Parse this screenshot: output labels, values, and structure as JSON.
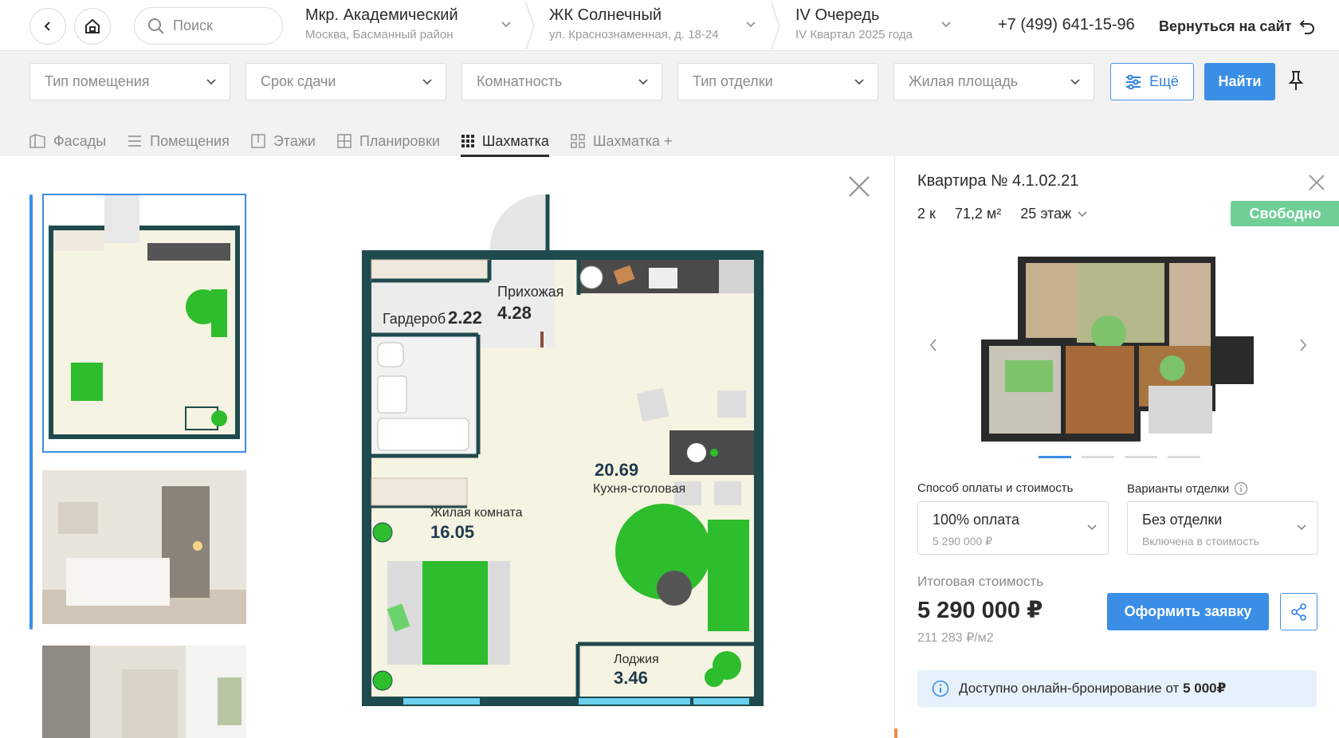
{
  "header": {
    "search_placeholder": "Поиск",
    "district": {
      "title": "Мкр. Академический",
      "subtitle": "Москва, Басманный район"
    },
    "complex": {
      "title": "ЖК Солнечный",
      "subtitle": "ул. Краснознаменная, д. 18-24"
    },
    "stage": {
      "title": "IV Очередь",
      "subtitle": "IV Квартал 2025 года"
    },
    "phone": "+7 (499) 641-15-96",
    "back_to_site": "Вернуться на сайт"
  },
  "filters": {
    "items": [
      "Тип помещения",
      "Срок сдачи",
      "Комнатность",
      "Тип отделки",
      "Жилая площадь"
    ],
    "more_label": "Ещё",
    "find_label": "Найти"
  },
  "tabs": [
    {
      "label": "Фасады",
      "icon": "facade-icon"
    },
    {
      "label": "Помещения",
      "icon": "list-icon"
    },
    {
      "label": "Этажи",
      "icon": "floors-icon"
    },
    {
      "label": "Планировки",
      "icon": "layouts-icon"
    },
    {
      "label": "Шахматка",
      "icon": "grid-dots-icon",
      "active": true
    },
    {
      "label": "Шахматка +",
      "icon": "grid-plus-icon"
    }
  ],
  "plan": {
    "wardrobe": {
      "name": "Гардероб",
      "area": "2.22"
    },
    "hall": {
      "name": "Прихожая",
      "area": "4.28"
    },
    "kitchen": {
      "area": "20.69",
      "name": "Кухня-столовая"
    },
    "living": {
      "name": "Жилая комната",
      "area": "16.05"
    },
    "loggia": {
      "name": "Лоджия",
      "area": "3.46"
    }
  },
  "panel": {
    "title": "Квартира № 4.1.02.21",
    "rooms": "2 к",
    "area": "71,2 м²",
    "floor": "25 этаж",
    "status": "Свободно",
    "payment_label": "Способ оплаты и стоимость",
    "payment_value": "100% оплата",
    "payment_hint": "5 290 000 ₽",
    "finish_label": "Варианты отделки",
    "finish_value": "Без отделки",
    "finish_hint": "Включена в стоимость",
    "total_label": "Итоговая стоимость",
    "total_price": "5 290 000 ₽",
    "price_per_m2": "211 283 ₽/м2",
    "apply_label": "Оформить заявку",
    "booking_text": "Доступно онлайн-бронирование от",
    "booking_amount": "5 000₽"
  },
  "colors": {
    "accent": "#3a8ee6",
    "status": "#6fcf97",
    "wall": "#1f4a4e",
    "floor": "#f5f3e1",
    "green": "#2dbd2d"
  }
}
